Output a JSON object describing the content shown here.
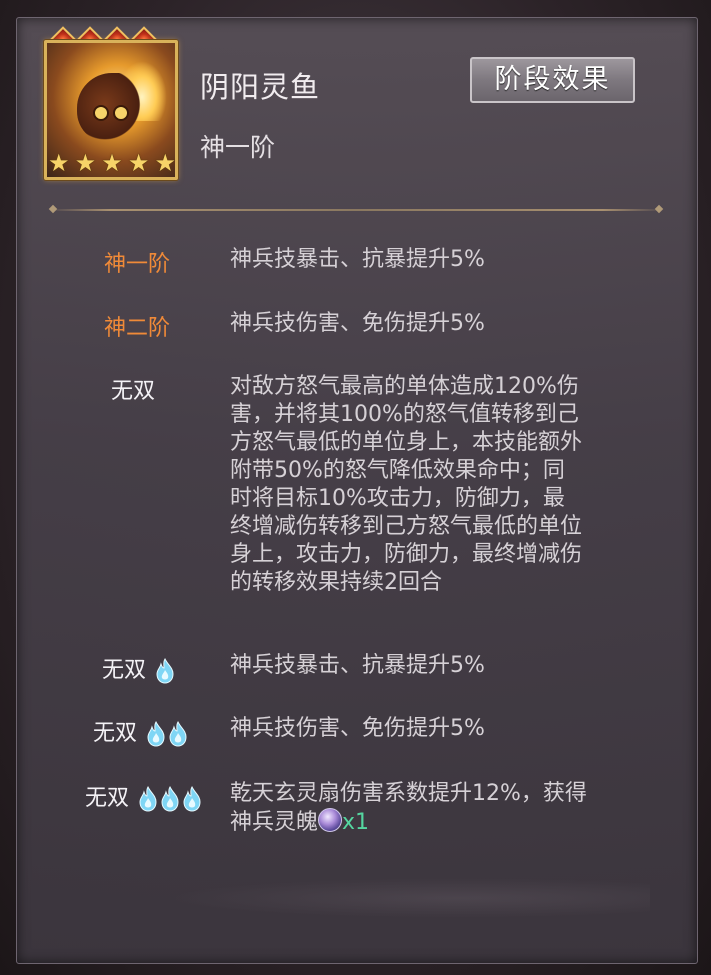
{
  "header": {
    "title": "阴阳灵鱼",
    "subtitle": "神一阶",
    "stage_button": "阶段效果",
    "stars": 5,
    "diamonds": 4
  },
  "rows": [
    {
      "label": "神一阶",
      "desc": "神兵技暴击、抗暴提升5%"
    },
    {
      "label": "神二阶",
      "desc": "神兵技伤害、免伤提升5%"
    },
    {
      "label": "无双",
      "desc_lines": [
        "对敌方怒气最高的单体造成120%伤",
        "害，并将其100%的怒气值转移到己",
        "方怒气最低的单位身上，本技能额外",
        "附带50%的怒气降低效果命中；同",
        "时将目标10%攻击力，防御力，最",
        "终增减伤转移到己方怒气最低的单位",
        "身上，攻击力，防御力，最终增减伤",
        "的转移效果持续2回合"
      ]
    },
    {
      "label": "无双",
      "flames": 1,
      "desc": "神兵技暴击、抗暴提升5%"
    },
    {
      "label": "无双",
      "flames": 2,
      "desc": "神兵技伤害、免伤提升5%"
    },
    {
      "label": "无双",
      "flames": 3,
      "desc_line1": "乾天玄灵扇伤害系数提升12%，获得",
      "desc_line2": "神兵灵魄",
      "reward_count": "x1"
    }
  ],
  "colors": {
    "label_stage": "#f08a38",
    "label_special": "#f4f2f6",
    "desc_text": "#d6d1d6",
    "reward_green": "#55d6a0",
    "star_gold": "#f7d468"
  },
  "icons": {
    "flame": "blue-flame-icon",
    "soul": "soul-orb-icon",
    "star": "star-icon",
    "diamond": "diamond-gem-icon"
  }
}
